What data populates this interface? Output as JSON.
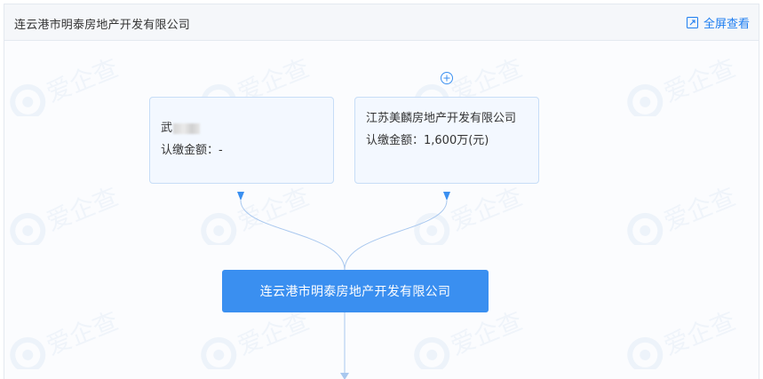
{
  "header": {
    "title": "连云港市明泰房地产开发有限公司",
    "fullscreen_label": "全屏查看"
  },
  "watermark": {
    "text": "爱企查"
  },
  "shareholders": [
    {
      "name": "武",
      "name_masked": true,
      "amount_label": "认缴金额：-"
    },
    {
      "name": "江苏美麟房地产开发有限公司",
      "amount_label": "认缴金额：1,600万(元)"
    }
  ],
  "company_node": {
    "label": "连云港市明泰房地产开发有限公司"
  },
  "colors": {
    "accent": "#3a8ff0",
    "link": "#1e7ef0",
    "card_bg": "#f3f8ff",
    "card_border": "#c7ddf7"
  }
}
